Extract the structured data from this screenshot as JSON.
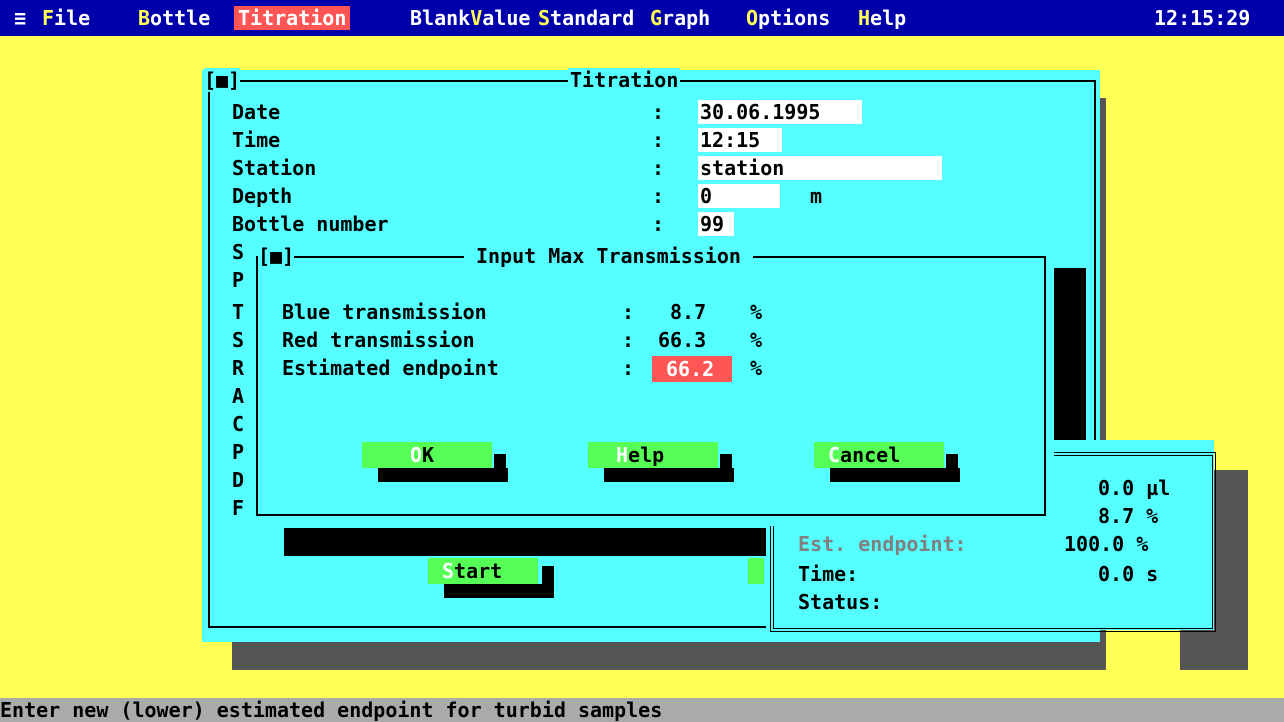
{
  "menu": {
    "system_icon": "≡",
    "items": [
      {
        "label": "File"
      },
      {
        "label": "Bottle"
      },
      {
        "label": "Titration"
      },
      {
        "label": "BlankValue"
      },
      {
        "label": "Standard"
      },
      {
        "label": "Graph"
      },
      {
        "label": "Options"
      },
      {
        "label": "Help"
      }
    ],
    "clock": "12:15:29"
  },
  "titration": {
    "title": "Titration",
    "close_box": "[■]",
    "fields": [
      {
        "label": "Date",
        "sep": ":",
        "value": "30.06.1995"
      },
      {
        "label": "Time",
        "sep": ":",
        "value": "12:15"
      },
      {
        "label": "Station",
        "sep": ":",
        "value": "station"
      },
      {
        "label": "Depth",
        "sep": ":",
        "value": "0",
        "unit": "m"
      },
      {
        "label": "Bottle number",
        "sep": ":",
        "value": "99"
      }
    ],
    "hidden_labels": [
      "S",
      "P",
      "T",
      "S",
      "R",
      "A",
      "C",
      "P",
      "D",
      "F"
    ],
    "start_button": "Start"
  },
  "status_panel": {
    "rows": [
      {
        "value": "0.0 µl"
      },
      {
        "value": "8.7 %"
      },
      {
        "label": "Est. endpoint:",
        "value": "100.0 %"
      },
      {
        "label": "Time:",
        "value": "0.0 s"
      },
      {
        "label": "Status:",
        "value": ""
      }
    ]
  },
  "dialog": {
    "close_box": "[■]",
    "title": "Input Max Transmission",
    "rows": [
      {
        "label": "Blue transmission",
        "sep": ":",
        "value": "8.7",
        "unit": "%"
      },
      {
        "label": "Red transmission",
        "sep": ":",
        "value": "66.3",
        "unit": "%"
      },
      {
        "label": "Estimated endpoint",
        "sep": ":",
        "value": "66.2",
        "unit": "%"
      }
    ],
    "buttons": {
      "ok": "OK",
      "help": "Help",
      "cancel": "Cancel"
    }
  },
  "statusbar": {
    "text": "Enter new (lower) estimated endpoint for turbid samples"
  },
  "colors": {
    "desktop": "#ffff55",
    "menu_bg": "#0000aa",
    "selected_menu": "#ff5555",
    "dialog_bg": "#55ffff",
    "button": "#55ff55",
    "focus_field": "#ff5555"
  }
}
